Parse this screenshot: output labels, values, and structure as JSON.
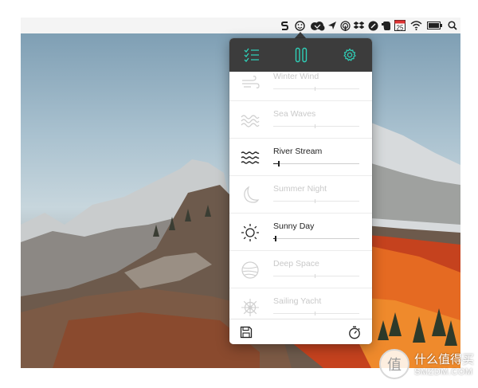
{
  "menubar": {
    "icons": [
      "s-app-icon",
      "smiley-icon",
      "cloud-app-icon",
      "send-icon",
      "airdrop-icon",
      "dropbox-icon",
      "circle-app-icon",
      "evernote-icon",
      "calendar-icon",
      "wifi-icon",
      "battery-icon",
      "search-icon"
    ],
    "calendar_day": "25",
    "battery_label": "[+]"
  },
  "popover": {
    "header": {
      "icons": [
        "checklist-icon",
        "pause-icon",
        "gear-icon"
      ],
      "accent_color": "#2fd0b8"
    },
    "sounds": [
      {
        "name": "Winter Wind",
        "icon": "wind-icon",
        "active": false,
        "level": 0.48
      },
      {
        "name": "Sea Waves",
        "icon": "waves-icon",
        "active": false,
        "level": 0.48
      },
      {
        "name": "River Stream",
        "icon": "river-icon",
        "active": true,
        "level": 0.06
      },
      {
        "name": "Summer Night",
        "icon": "moon-icon",
        "active": false,
        "level": 0.48
      },
      {
        "name": "Sunny Day",
        "icon": "sun-icon",
        "active": true,
        "level": 0.02
      },
      {
        "name": "Deep Space",
        "icon": "planet-icon",
        "active": false,
        "level": 0.48
      },
      {
        "name": "Sailing Yacht",
        "icon": "ship-wheel-icon",
        "active": false,
        "level": 0.48
      }
    ],
    "footer": {
      "icons": [
        "save-icon",
        "timer-icon"
      ]
    }
  },
  "watermark": {
    "symbol": "值",
    "cn_text": "什么值得买",
    "en_text": "SMZDM.COM"
  }
}
